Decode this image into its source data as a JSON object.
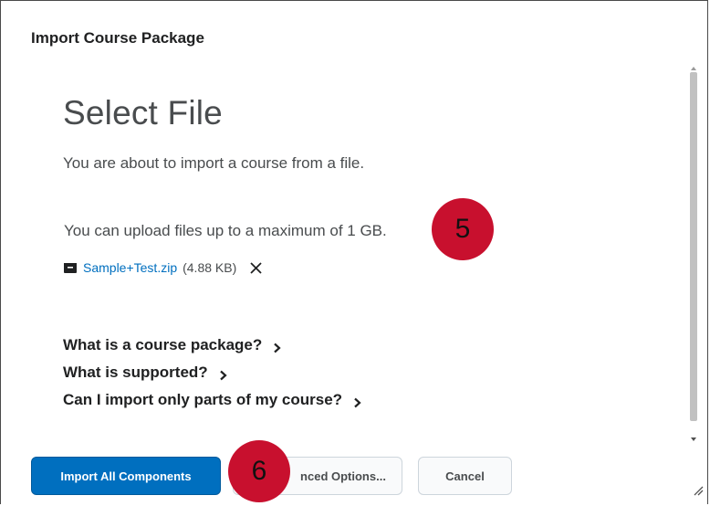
{
  "dialog": {
    "title": "Import Course Package"
  },
  "main": {
    "heading": "Select File",
    "intro": "You are about to import a course from a file.",
    "limit_text": "You can upload files up to a maximum of 1 GB."
  },
  "file": {
    "icon": "file-archive-icon",
    "name": "Sample+Test.zip",
    "size": "(4.88 KB)",
    "remove_icon": "close-icon"
  },
  "faq": [
    {
      "label": "What is a course package?"
    },
    {
      "label": "What is supported?"
    },
    {
      "label": "Can I import only parts of my course?"
    }
  ],
  "annotations": {
    "step5": "5",
    "step6": "6",
    "color": "#c8102e"
  },
  "footer": {
    "import_all": "Import All Components",
    "advanced": "nced Options...",
    "cancel": "Cancel"
  },
  "colors": {
    "primary": "#006fbf",
    "link": "#006fbf",
    "text": "#494c4e"
  }
}
